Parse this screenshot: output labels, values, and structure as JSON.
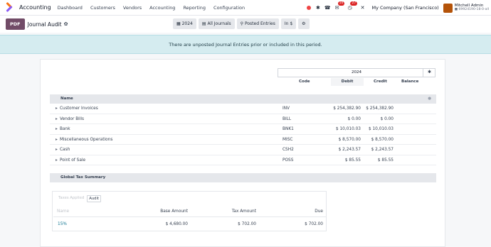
{
  "navbar": {
    "app_name": "Accounting",
    "menu": [
      "Dashboard",
      "Customers",
      "Vendors",
      "Accounting",
      "Reporting",
      "Configuration"
    ],
    "messages_count": "10",
    "activities_count": "27",
    "company": "My Company (San Francisco)",
    "user_name": "Mitchell Admin",
    "user_db": "■ 69924190-18-0-all"
  },
  "control": {
    "pdf_label": "PDF",
    "breadcrumb": "Journal Audit",
    "filter_year": "2024",
    "filter_journals": "All Journals",
    "filter_posted": "Posted Entries",
    "filter_currency": "In $"
  },
  "banner": {
    "text": "There are unposted Journal Entries prior or included in this period."
  },
  "report": {
    "period": "2024",
    "columns": {
      "code": "Code",
      "debit": "Debit",
      "credit": "Credit",
      "balance": "Balance"
    },
    "journals_section": "Name",
    "rows": [
      {
        "name": "Customer Invoices",
        "code": "INV",
        "debit": "$ 254,382.90",
        "credit": "$ 254,382.90"
      },
      {
        "name": "Vendor Bills",
        "code": "BILL",
        "debit": "$ 0.00",
        "credit": "$ 0.00"
      },
      {
        "name": "Bank",
        "code": "BNK1",
        "debit": "$ 10,010.03",
        "credit": "$ 10,010.03"
      },
      {
        "name": "Miscellaneous Operations",
        "code": "MISC",
        "debit": "$ 8,570.00",
        "credit": "$ 8,570.00"
      },
      {
        "name": "Cash",
        "code": "CSH2",
        "debit": "$ 2,243.57",
        "credit": "$ 2,243.57"
      },
      {
        "name": "Point of Sale",
        "code": "POSS",
        "debit": "$ 85.55",
        "credit": "$ 85.55"
      }
    ],
    "tax_section": "Global Tax Summary",
    "tax_tabs": [
      "Taxes Applied",
      "Audit"
    ],
    "tax_headers": {
      "name": "Name",
      "base": "Base Amount",
      "tax": "Tax Amount",
      "due": "Due"
    },
    "tax_row": {
      "name": "15%",
      "base": "$ 4,680.00",
      "tax": "$ 702.00",
      "due": "$ 702.00"
    }
  },
  "icons": {
    "apps": "apps-icon",
    "gear": "gear-icon",
    "calendar": "calendar-icon",
    "book": "book-icon",
    "filter": "filter-icon",
    "options": "sliders-icon"
  },
  "colors": {
    "brand": "#714b67",
    "banner_bg": "#d5ecf0",
    "badge": "#dc2626",
    "link": "#0e7490"
  }
}
